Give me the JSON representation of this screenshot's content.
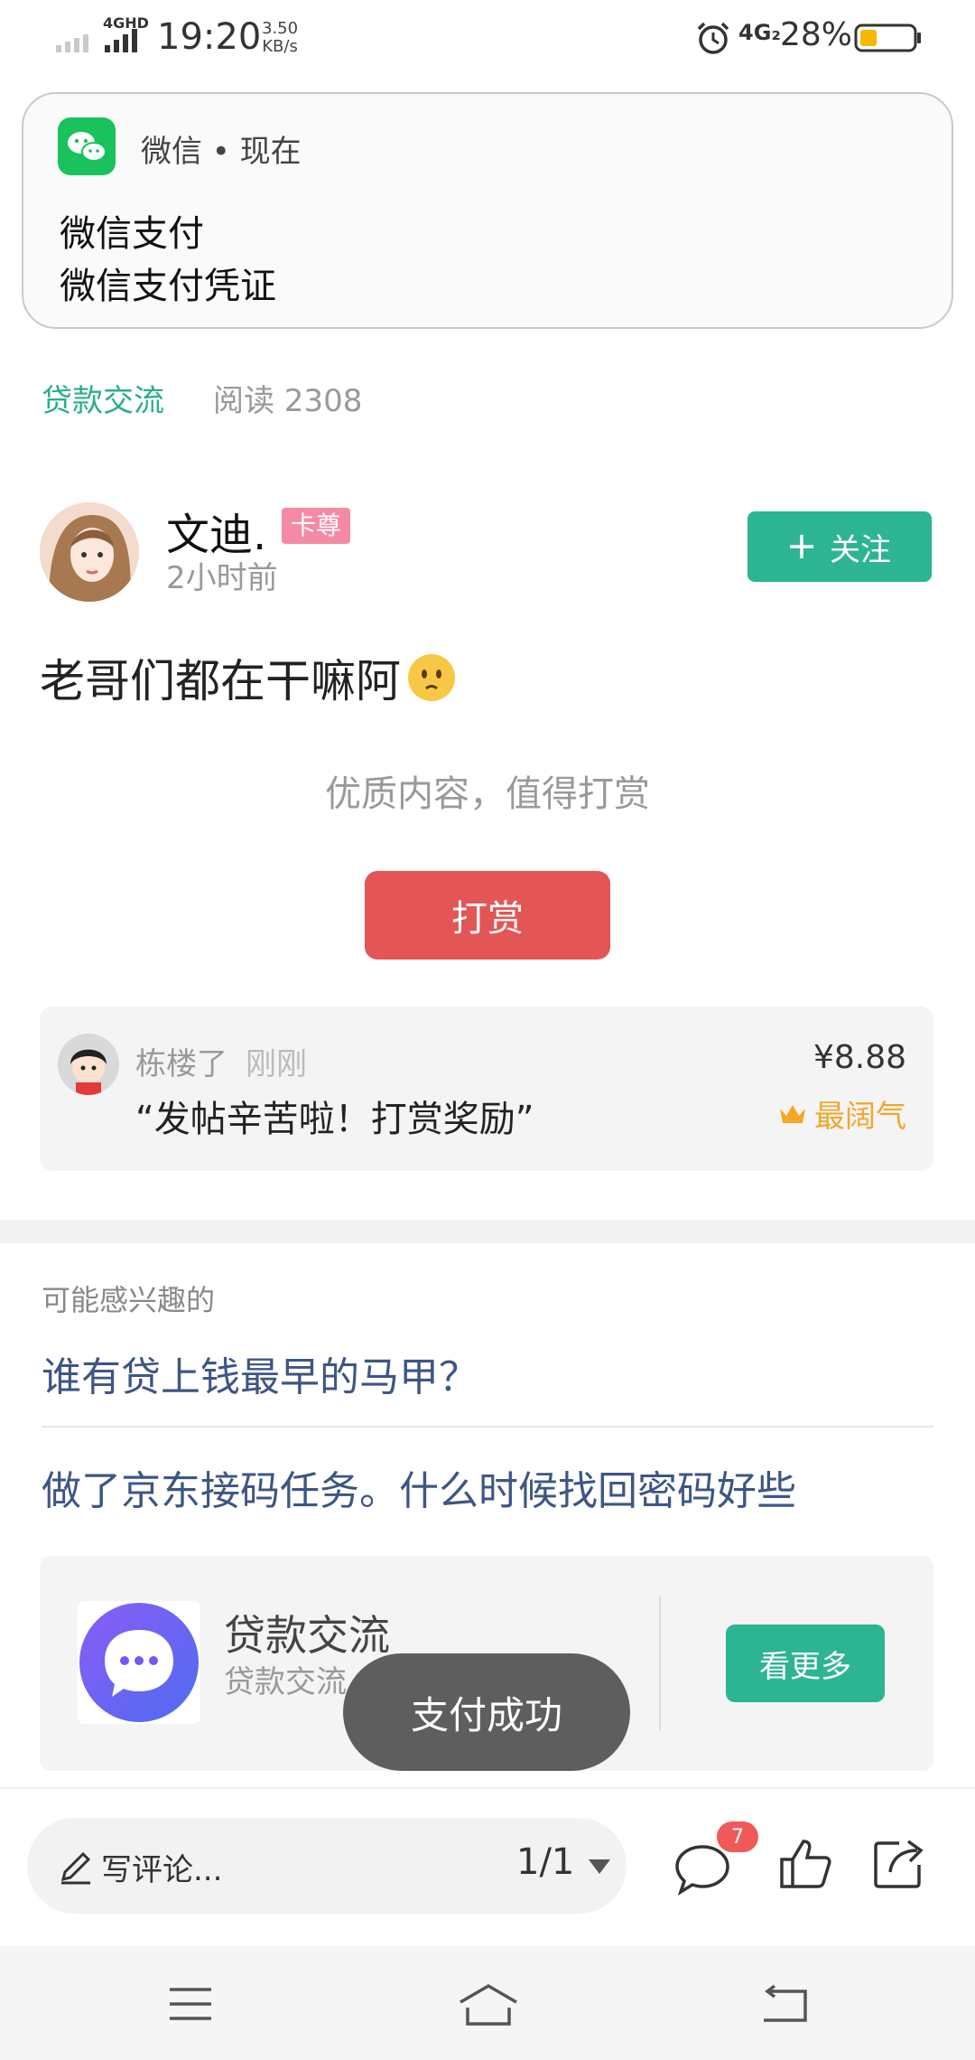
{
  "status_bar": {
    "network": "4GHD",
    "time": "19:20",
    "speed_value": "3.50",
    "speed_unit": "KB/s",
    "mobile": "4G₂",
    "battery": "28%",
    "icons": [
      "signal-icon",
      "alarm-icon",
      "battery-icon"
    ]
  },
  "notification": {
    "app": "微信 • 现在",
    "title": "微信支付",
    "body": "微信支付凭证",
    "accent": "#19c25b"
  },
  "post": {
    "topic": "贷款交流",
    "reads": "阅读 2308",
    "author": "文迪.",
    "vip_badge": "卡尊",
    "time_ago": "2小时前",
    "follow_label": "关注",
    "content": "老哥们都在干嘛阿",
    "tip_hint": "优质内容，值得打赏",
    "tip_button": "打赏"
  },
  "tip_record": {
    "user": "栋楼了",
    "when": "刚刚",
    "message": "“发帖辛苦啦！打赏奖励”",
    "amount": "¥8.88",
    "rank": "最阔气"
  },
  "related": {
    "title": "可能感兴趣的",
    "items": [
      "谁有贷上钱最早的马甲？",
      "做了京东接码任务。什么时候找回密码好些"
    ]
  },
  "topic_card": {
    "name": "贷款交流",
    "subtitle": "贷款交流",
    "more_label": "看更多"
  },
  "toast": "支付成功",
  "bottom_bar": {
    "comment_placeholder": "写评论...",
    "page": "1/1",
    "comment_count": "7"
  },
  "colors": {
    "accent_green": "#2db493",
    "tip_red": "#e45556",
    "link_blue": "#3d5684"
  }
}
